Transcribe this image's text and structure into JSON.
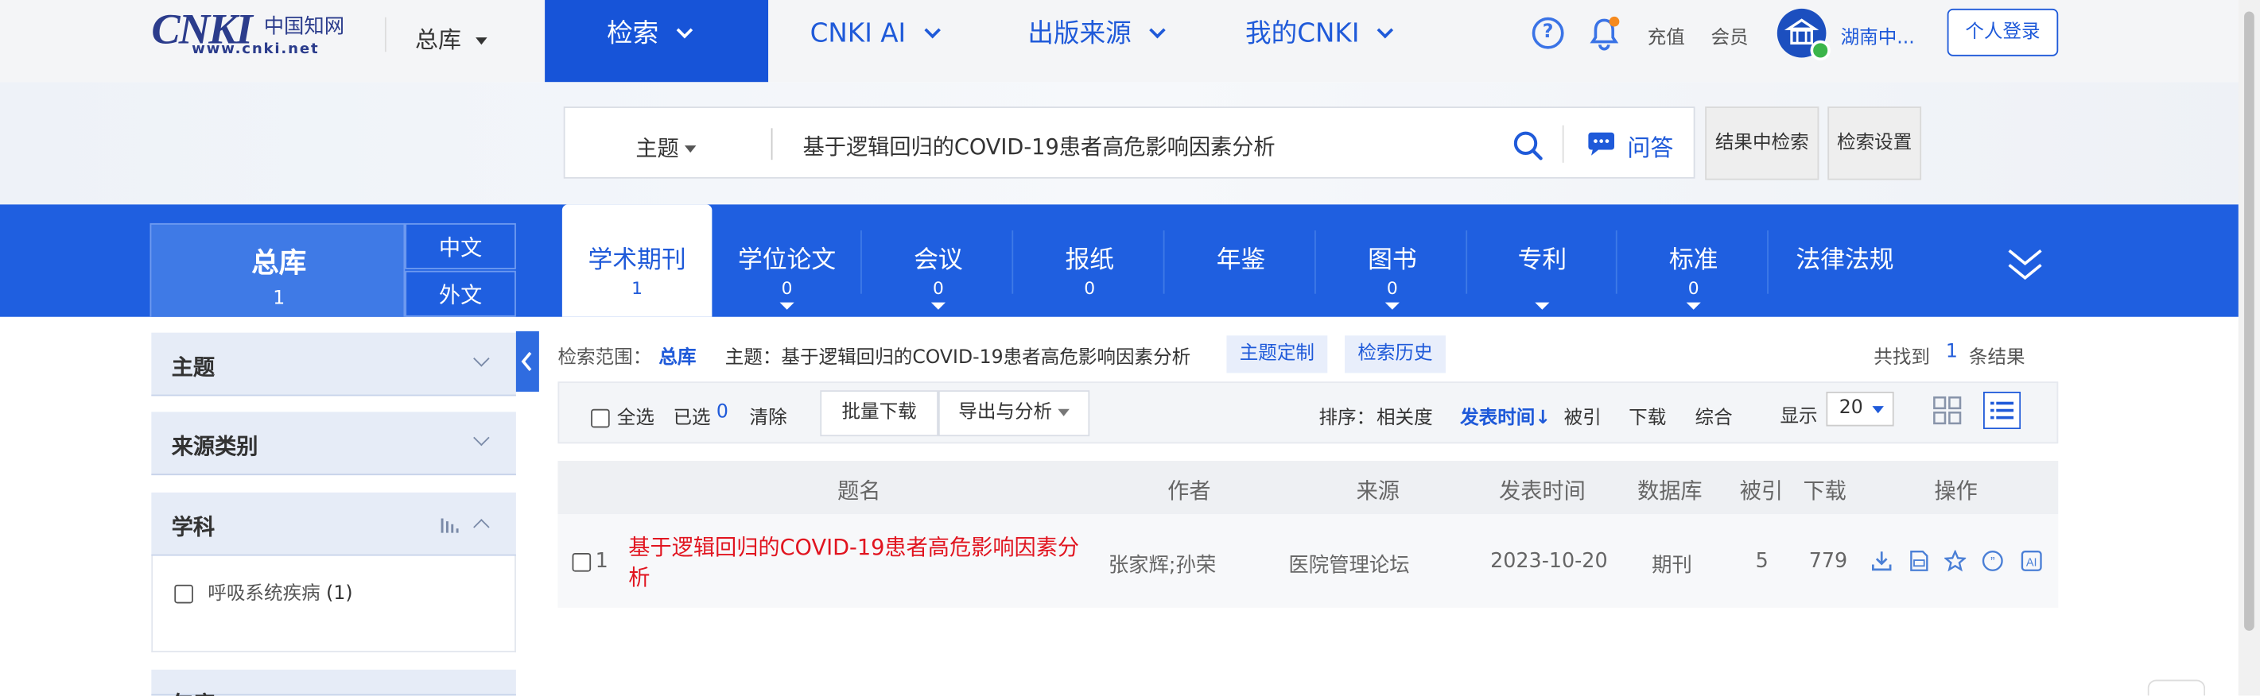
{
  "header": {
    "logo_text": "CNKI",
    "logo_cn": "中国知网",
    "logo_url": "www.cnki.net",
    "scope_label": "总库",
    "nav": [
      "检索",
      "CNKI AI",
      "出版来源",
      "我的CNKI"
    ],
    "recharge": "充值",
    "member": "会员",
    "institution": "湖南中...",
    "login": "个人登录"
  },
  "search": {
    "field": "主题",
    "query": "基于逻辑回归的COVID-19患者高危影响因素分析",
    "qa_label": "问答",
    "in_results": "结果中检索",
    "settings": "检索设置"
  },
  "db_tabs": {
    "zongku": {
      "label": "总库",
      "count": "1"
    },
    "zh": "中文",
    "wai": "外文",
    "tabs": [
      {
        "label": "学术期刊",
        "count": "1"
      },
      {
        "label": "学位论文",
        "count": "0"
      },
      {
        "label": "会议",
        "count": "0"
      },
      {
        "label": "报纸",
        "count": "0"
      },
      {
        "label": "年鉴",
        "count": ""
      },
      {
        "label": "图书",
        "count": "0"
      },
      {
        "label": "专利",
        "count": ""
      },
      {
        "label": "标准",
        "count": "0"
      },
      {
        "label": "法律法规",
        "count": ""
      }
    ]
  },
  "facets": {
    "topic": "主题",
    "source_type": "来源类别",
    "subject": "学科",
    "subject_item": "呼吸系统疾病",
    "subject_item_count": "(1)",
    "year_partial": "年度"
  },
  "results": {
    "scope_label": "检索范围：",
    "scope_value": "总库",
    "topic_label": "主题：基于逻辑回归的COVID-19患者高危影响因素分析",
    "topic_custom": "主题定制",
    "history": "检索历史",
    "found_prefix": "共找到",
    "found_count": "1",
    "found_suffix": "条结果",
    "select_all": "全选",
    "selected_label": "已选",
    "selected_count": "0",
    "clear": "清除",
    "batch_download": "批量下载",
    "export": "导出与分析",
    "sort_label": "排序：",
    "sort_relevance": "相关度",
    "sort_date": "发表时间",
    "sort_cited": "被引",
    "sort_download": "下载",
    "sort_overall": "综合",
    "display_label": "显示",
    "page_size": "20",
    "columns": [
      "题名",
      "作者",
      "来源",
      "发表时间",
      "数据库",
      "被引",
      "下载",
      "操作"
    ],
    "rows": [
      {
        "index": "1",
        "title": "基于逻辑回归的COVID-19患者高危影响因素分析",
        "authors": "张家辉;孙荣",
        "source": "医院管理论坛",
        "date": "2023-10-20",
        "db": "期刊",
        "cited": "5",
        "downloads": "779"
      }
    ]
  },
  "colors": {
    "brand_blue": "#1f5fe0",
    "title_red": "#e1141f",
    "link_blue": "#1f5ad9"
  }
}
